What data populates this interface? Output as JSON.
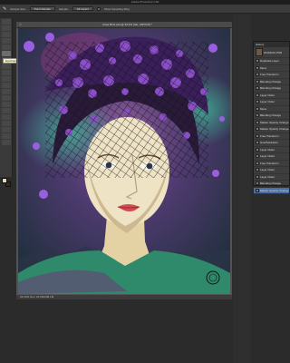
{
  "app": {
    "title": "Adobe Photoshop CS6"
  },
  "options_bar": {
    "items": [
      {
        "label": "Sample Size:",
        "value": "Point Sample"
      },
      {
        "label": "Sample:",
        "value": "All Layers"
      }
    ],
    "checkbox_label": "Show Sampling Ring"
  },
  "toolbar": {
    "tooltip": "Eyedropper Tool (I)"
  },
  "document": {
    "tab_label": "Issue Bin2.psd @ 33.3% (hat, CMYK/8) *",
    "status": "33.33%   Doc: 25.6M/208.1M"
  },
  "history_panel": {
    "title": "History",
    "snapshot_label": "20191101.PSD",
    "steps": [
      "Duplicate Layer",
      "Move",
      "Free Transform",
      "Blending Change",
      "Blending Change",
      "Layer Order",
      "Layer Order",
      "Move",
      "Blending Change",
      "Master Opacity Change",
      "Master Opacity Change",
      "Free Transform",
      "Hue/Saturation",
      "Layer Order",
      "Layer Order",
      "Free Transform",
      "Layer Order",
      "Layer Order",
      "Blending Change",
      "Master Opacity Change"
    ],
    "selected_index": 19
  },
  "colors": {
    "foreground": "#e6d9b6",
    "background": "#3a2a1e",
    "ui_dark": "#2b2b2b",
    "selection": "#4a6fa4"
  }
}
